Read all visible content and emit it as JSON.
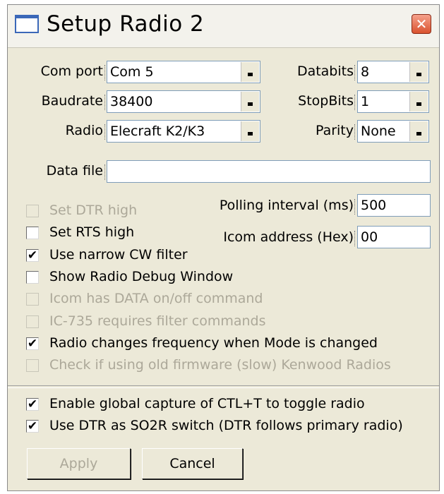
{
  "window": {
    "title": "Setup Radio 2"
  },
  "fields": {
    "com_port": {
      "label": "Com port",
      "value": "Com 5"
    },
    "databits": {
      "label": "Databits",
      "value": "8"
    },
    "baudrate": {
      "label": "Baudrate",
      "value": "38400"
    },
    "stopbits": {
      "label": "StopBits",
      "value": "1"
    },
    "radio": {
      "label": "Radio",
      "value": "Elecraft K2/K3"
    },
    "parity": {
      "label": "Parity",
      "value": "None"
    },
    "data_file": {
      "label": "Data file",
      "value": ""
    },
    "polling_interval": {
      "label": "Polling interval (ms)",
      "value": "500"
    },
    "icom_address": {
      "label": "Icom address (Hex)",
      "value": "00"
    }
  },
  "checkboxes": [
    {
      "label": "Set DTR high",
      "checked": false,
      "enabled": false
    },
    {
      "label": "Set RTS high",
      "checked": false,
      "enabled": true
    },
    {
      "label": "Use narrow CW filter",
      "checked": true,
      "enabled": true
    },
    {
      "label": "Show Radio Debug Window",
      "checked": false,
      "enabled": true
    },
    {
      "label": "Icom has DATA on/off command",
      "checked": false,
      "enabled": false
    },
    {
      "label": "IC-735 requires filter commands",
      "checked": false,
      "enabled": false
    },
    {
      "label": "Radio changes frequency when Mode is changed",
      "checked": true,
      "enabled": true
    },
    {
      "label": "Check if using old firmware (slow) Kenwood Radios",
      "checked": false,
      "enabled": false
    }
  ],
  "global_checkboxes": [
    {
      "label": "Enable global capture of CTL+T to toggle radio",
      "checked": true,
      "enabled": true
    },
    {
      "label": "Use DTR as SO2R switch (DTR follows primary radio)",
      "checked": true,
      "enabled": true
    }
  ],
  "buttons": {
    "apply": {
      "label": "Apply",
      "enabled": false
    },
    "cancel": {
      "label": "Cancel",
      "enabled": true
    }
  },
  "check_mark": "✔",
  "close_glyph": "✕"
}
